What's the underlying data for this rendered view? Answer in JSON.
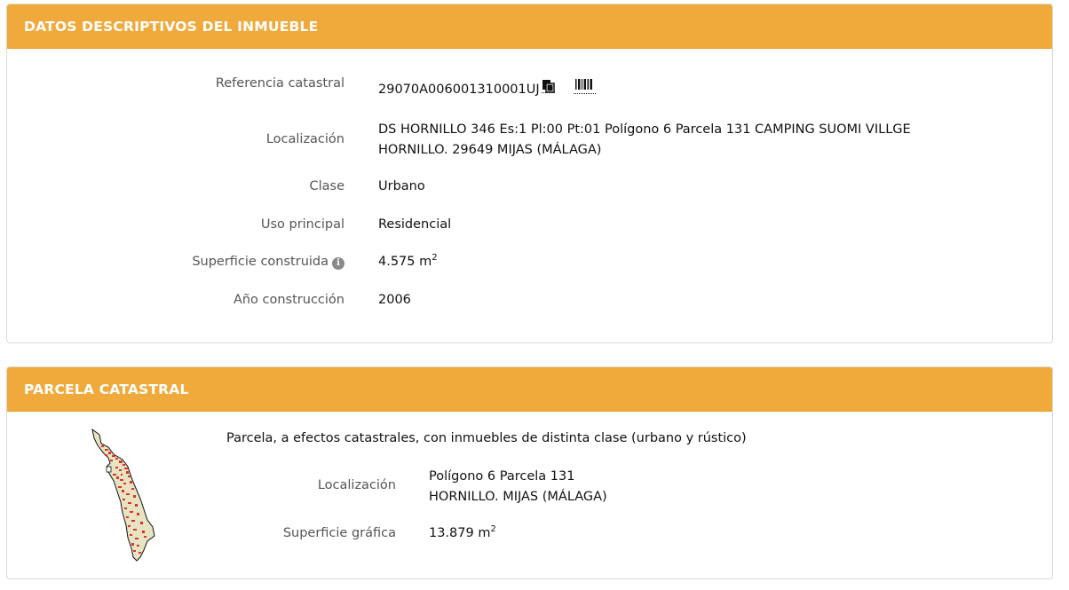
{
  "datos": {
    "title": "DATOS DESCRIPTIVOS DEL INMUEBLE",
    "rows": [
      {
        "label": "Referencia catastral",
        "value": "29070A006001310001UJ"
      },
      {
        "label": "Localización",
        "value_line1": "DS HORNILLO 346 Es:1 Pl:00 Pt:01 Polígono 6 Parcela 131 CAMPING SUOMI VILLGE",
        "value_line2": "HORNILLO. 29649 MIJAS (MÁLAGA)"
      },
      {
        "label": "Clase",
        "value": "Urbano"
      },
      {
        "label": "Uso principal",
        "value": "Residencial"
      },
      {
        "label": "Superficie construida",
        "value": "4.575 m",
        "unit_sup": "2",
        "info_icon": "i"
      },
      {
        "label": "Año construcción",
        "value": "2006"
      }
    ],
    "icons": [
      "copy-icon",
      "barcode-icon"
    ]
  },
  "parcela": {
    "title": "PARCELA CATASTRAL",
    "description": "Parcela, a efectos catastrales, con inmuebles de distinta clase (urbano y rústico)",
    "rows": [
      {
        "label": "Localización",
        "value_line1": "Polígono 6 Parcela 131",
        "value_line2": "HORNILLO. MIJAS (MÁLAGA)"
      },
      {
        "label": "Superficie gráfica",
        "value": "13.879 m",
        "unit_sup": "2"
      }
    ],
    "map_thumbnail": "parcel-map-thumbnail"
  },
  "colors": {
    "header_bg": "#f0aa3c",
    "header_text": "#ffffff",
    "parcel_fill": "#e8e3c2",
    "parcel_buildings": "#d9342b"
  }
}
